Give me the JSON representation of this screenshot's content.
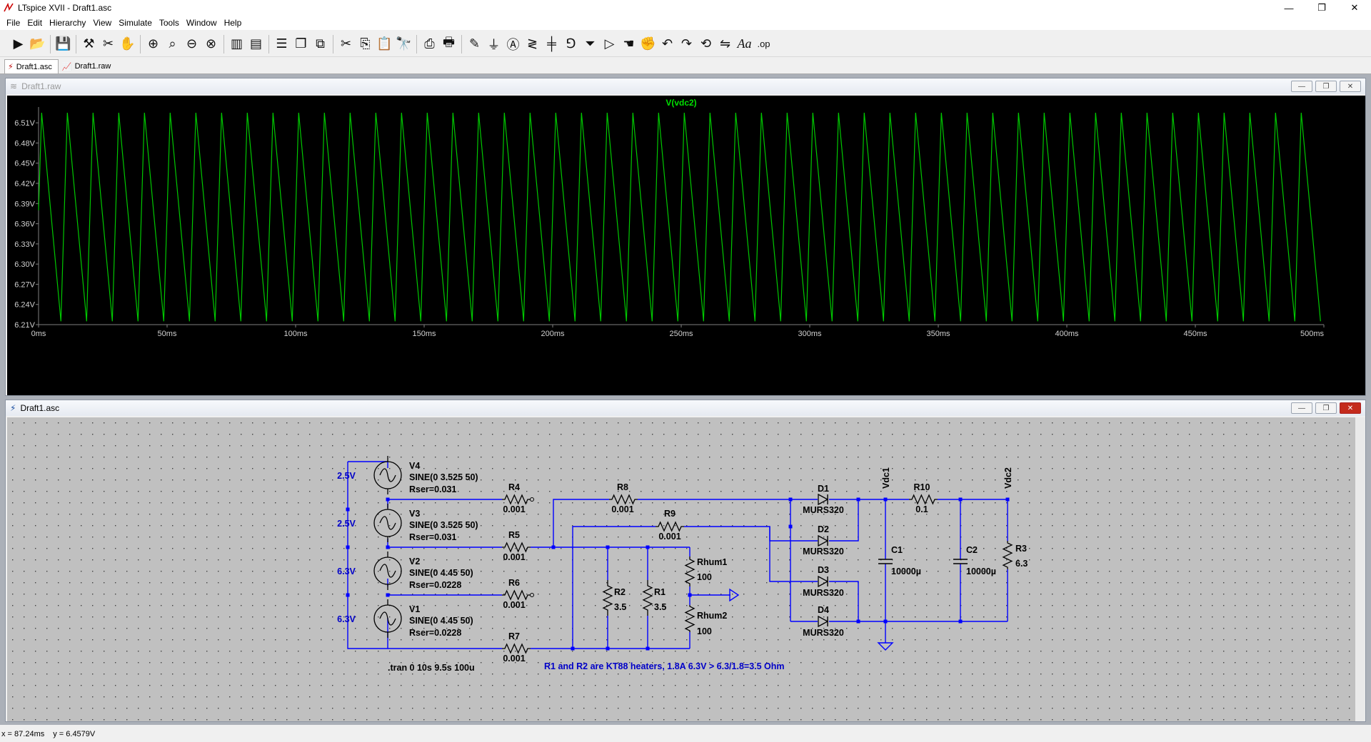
{
  "window": {
    "title": "LTspice XVII - Draft1.asc",
    "minimize": "—",
    "maximize": "❐",
    "close": "✕"
  },
  "menu": [
    "File",
    "Edit",
    "Hierarchy",
    "View",
    "Simulate",
    "Tools",
    "Window",
    "Help"
  ],
  "toolbar_icons": [
    "run-icon",
    "open-icon",
    "save-icon",
    "control-panel-icon",
    "halt-icon",
    "pan-hand-icon",
    "zoom-in-icon",
    "zoom-area-icon",
    "zoom-out-icon",
    "zoom-fit-icon",
    "autorange-icon",
    "delete-trace-icon",
    "tile-horizontal-icon",
    "cascade-icon",
    "close-windows-icon",
    "cut-icon",
    "copy-icon",
    "paste-icon",
    "find-icon",
    "print-icon",
    "print-setup-icon",
    "wire-icon",
    "ground-icon",
    "label-icon",
    "resistor-icon",
    "capacitor-icon",
    "inductor-icon",
    "diode-icon",
    "component-icon",
    "move-icon",
    "drag-icon",
    "undo-icon",
    "redo-icon",
    "rotate-icon",
    "mirror-icon",
    "text-icon",
    "spice-directive-icon"
  ],
  "tabs": [
    {
      "label": "Draft1.asc",
      "active": true
    },
    {
      "label": "Draft1.raw",
      "active": false
    }
  ],
  "waveform_window": {
    "title": "Draft1.raw",
    "trace_name": "V(vdc2)"
  },
  "chart_data": {
    "type": "line",
    "title": "V(vdc2)",
    "series": [
      {
        "name": "V(vdc2)",
        "color": "#00c800",
        "waveform": "sawtooth",
        "period_ms": 10,
        "min": 6.215,
        "max": 6.525
      }
    ],
    "x_ticks": [
      "0ms",
      "50ms",
      "100ms",
      "150ms",
      "200ms",
      "250ms",
      "300ms",
      "350ms",
      "400ms",
      "450ms",
      "500ms"
    ],
    "y_ticks": [
      "6.51V",
      "6.48V",
      "6.45V",
      "6.42V",
      "6.39V",
      "6.36V",
      "6.33V",
      "6.30V",
      "6.27V",
      "6.24V",
      "6.21V"
    ],
    "xlim_ms": [
      0,
      500
    ],
    "ylim_v": [
      6.21,
      6.525
    ],
    "background": "#000000",
    "grid": false
  },
  "schematic_window": {
    "title": "Draft1.asc",
    "sources": [
      {
        "name": "V4",
        "func": "SINE(0 3.525 50)",
        "rser": "Rser=0.031",
        "voltage_label": "2.5V"
      },
      {
        "name": "V3",
        "func": "SINE(0 3.525 50)",
        "rser": "Rser=0.031",
        "voltage_label": "2.5V"
      },
      {
        "name": "V2",
        "func": "SINE(0 4.45 50)",
        "rser": "Rser=0.0228",
        "voltage_label": "6.3V"
      },
      {
        "name": "V1",
        "func": "SINE(0 4.45 50)",
        "rser": "Rser=0.0228",
        "voltage_label": "6.3V"
      }
    ],
    "resistors": {
      "R4": {
        "name": "R4",
        "value": "0.001"
      },
      "R5": {
        "name": "R5",
        "value": "0.001"
      },
      "R6": {
        "name": "R6",
        "value": "0.001"
      },
      "R7": {
        "name": "R7",
        "value": "0.001"
      },
      "R8": {
        "name": "R8",
        "value": "0.001"
      },
      "R9": {
        "name": "R9",
        "value": "0.001"
      },
      "R2": {
        "name": "R2",
        "value": "3.5"
      },
      "R1": {
        "name": "R1",
        "value": "3.5"
      },
      "Rhum1": {
        "name": "Rhum1",
        "value": "100"
      },
      "Rhum2": {
        "name": "Rhum2",
        "value": "100"
      },
      "R10": {
        "name": "R10",
        "value": "0.1"
      },
      "R3": {
        "name": "R3",
        "value": "6.3"
      }
    },
    "diodes": [
      {
        "name": "D1",
        "model": "MURS320"
      },
      {
        "name": "D2",
        "model": "MURS320"
      },
      {
        "name": "D3",
        "model": "MURS320"
      },
      {
        "name": "D4",
        "model": "MURS320"
      }
    ],
    "capacitors": [
      {
        "name": "C1",
        "value": "10000µ"
      },
      {
        "name": "C2",
        "value": "10000µ"
      }
    ],
    "net_labels": [
      "Vdc1",
      "Vdc2"
    ],
    "directive": ".tran 0 10s 9.5s 100u",
    "comment": "R1 and R2 are KT88 heaters, 1.8A 6.3V > 6.3/1.8=3.5 Ohm",
    "wire_color": "#0000ff",
    "component_color": "#000000"
  },
  "status": {
    "x": "x = 87.24ms",
    "y": "y = 6.4579V"
  }
}
